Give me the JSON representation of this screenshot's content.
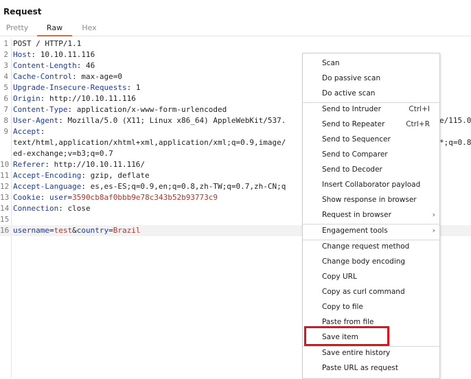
{
  "panel": {
    "title": "Request"
  },
  "tabs": [
    {
      "label": "Pretty",
      "active": false
    },
    {
      "label": "Raw",
      "active": true
    },
    {
      "label": "Hex",
      "active": false
    }
  ],
  "request": {
    "lines": [
      {
        "n": "1",
        "parts": [
          {
            "t": "POST / HTTP/1.1",
            "c": "hv"
          }
        ]
      },
      {
        "n": "2",
        "parts": [
          {
            "t": "Host",
            "c": "hk"
          },
          {
            "t": ": 10.10.11.116",
            "c": "hv"
          }
        ]
      },
      {
        "n": "3",
        "parts": [
          {
            "t": "Content-Length",
            "c": "hk"
          },
          {
            "t": ": 46",
            "c": "hv"
          }
        ]
      },
      {
        "n": "4",
        "parts": [
          {
            "t": "Cache-Control",
            "c": "hk"
          },
          {
            "t": ": max-age=0",
            "c": "hv"
          }
        ]
      },
      {
        "n": "5",
        "parts": [
          {
            "t": "Upgrade-Insecure-Requests",
            "c": "hk"
          },
          {
            "t": ": 1",
            "c": "hv"
          }
        ]
      },
      {
        "n": "6",
        "parts": [
          {
            "t": "Origin",
            "c": "hk"
          },
          {
            "t": ": http://10.10.11.116",
            "c": "hv"
          }
        ]
      },
      {
        "n": "7",
        "parts": [
          {
            "t": "Content-Type",
            "c": "hk"
          },
          {
            "t": ": application/x-www-form-urlencoded",
            "c": "hv"
          }
        ]
      },
      {
        "n": "8",
        "parts": [
          {
            "t": "User-Agent",
            "c": "hk"
          },
          {
            "t": ": Mozilla/5.0 (X11; Linux x86_64) AppleWebKit/537.",
            "c": "hv"
          }
        ],
        "tail": "e/115.0"
      },
      {
        "n": "9",
        "parts": [
          {
            "t": "Accept",
            "c": "hk"
          },
          {
            "t": ":",
            "c": "hv"
          }
        ]
      },
      {
        "n": "",
        "parts": [
          {
            "t": "text/html,application/xhtml+xml,application/xml;q=0.9,image/",
            "c": "hv"
          }
        ],
        "tail": "*;q=0.8"
      },
      {
        "n": "",
        "parts": [
          {
            "t": "ed-exchange;v=b3;q=0.7",
            "c": "hv"
          }
        ]
      },
      {
        "n": "10",
        "parts": [
          {
            "t": "Referer",
            "c": "hk"
          },
          {
            "t": ": http://10.10.11.116/",
            "c": "hv"
          }
        ]
      },
      {
        "n": "11",
        "parts": [
          {
            "t": "Accept-Encoding",
            "c": "hk"
          },
          {
            "t": ": gzip, deflate",
            "c": "hv"
          }
        ]
      },
      {
        "n": "12",
        "parts": [
          {
            "t": "Accept-Language",
            "c": "hk"
          },
          {
            "t": ": es,es-ES;q=0.9,en;q=0.8,zh-TW;q=0.7,zh-CN;q",
            "c": "hv"
          }
        ]
      },
      {
        "n": "13",
        "parts": [
          {
            "t": "Cookie",
            "c": "hk"
          },
          {
            "t": ": ",
            "c": "hv"
          },
          {
            "t": "user",
            "c": "hk"
          },
          {
            "t": "=",
            "c": "hv"
          },
          {
            "t": "3590cb8af0bbb9e78c343b52b93773c9",
            "c": "red"
          }
        ]
      },
      {
        "n": "14",
        "parts": [
          {
            "t": "Connection",
            "c": "hk"
          },
          {
            "t": ": close",
            "c": "hv"
          }
        ]
      },
      {
        "n": "15",
        "parts": []
      },
      {
        "n": "16",
        "parts": [
          {
            "t": "username",
            "c": "hk"
          },
          {
            "t": "=",
            "c": "hv"
          },
          {
            "t": "test",
            "c": "red"
          },
          {
            "t": "&",
            "c": "hv"
          },
          {
            "t": "country",
            "c": "hk"
          },
          {
            "t": "=",
            "c": "hv"
          },
          {
            "t": "Brazil",
            "c": "red"
          }
        ],
        "highlight": true
      }
    ]
  },
  "context_menu": {
    "items": [
      {
        "label": "Scan"
      },
      {
        "label": "Do passive scan"
      },
      {
        "label": "Do active scan",
        "sep_after": true
      },
      {
        "label": "Send to Intruder",
        "shortcut": "Ctrl+I"
      },
      {
        "label": "Send to Repeater",
        "shortcut": "Ctrl+R"
      },
      {
        "label": "Send to Sequencer"
      },
      {
        "label": "Send to Comparer"
      },
      {
        "label": "Send to Decoder"
      },
      {
        "label": "Insert Collaborator payload"
      },
      {
        "label": "Show response in browser"
      },
      {
        "label": "Request in browser",
        "submenu": true,
        "sep_after": true
      },
      {
        "label": "Engagement tools",
        "submenu": true,
        "sep_after": true
      },
      {
        "label": "Change request method"
      },
      {
        "label": "Change body encoding"
      },
      {
        "label": "Copy URL"
      },
      {
        "label": "Copy as curl command"
      },
      {
        "label": "Copy to file"
      },
      {
        "label": "Paste from file"
      },
      {
        "label": "Save item",
        "highlighted": true,
        "sep_after": true
      },
      {
        "label": "Save entire history"
      },
      {
        "label": "Paste URL as request"
      }
    ]
  },
  "colors": {
    "accent_tab": "#e8673c",
    "highlight_box": "#e0131b",
    "header_key": "#1c3aa9",
    "value_red": "#b8332a"
  }
}
